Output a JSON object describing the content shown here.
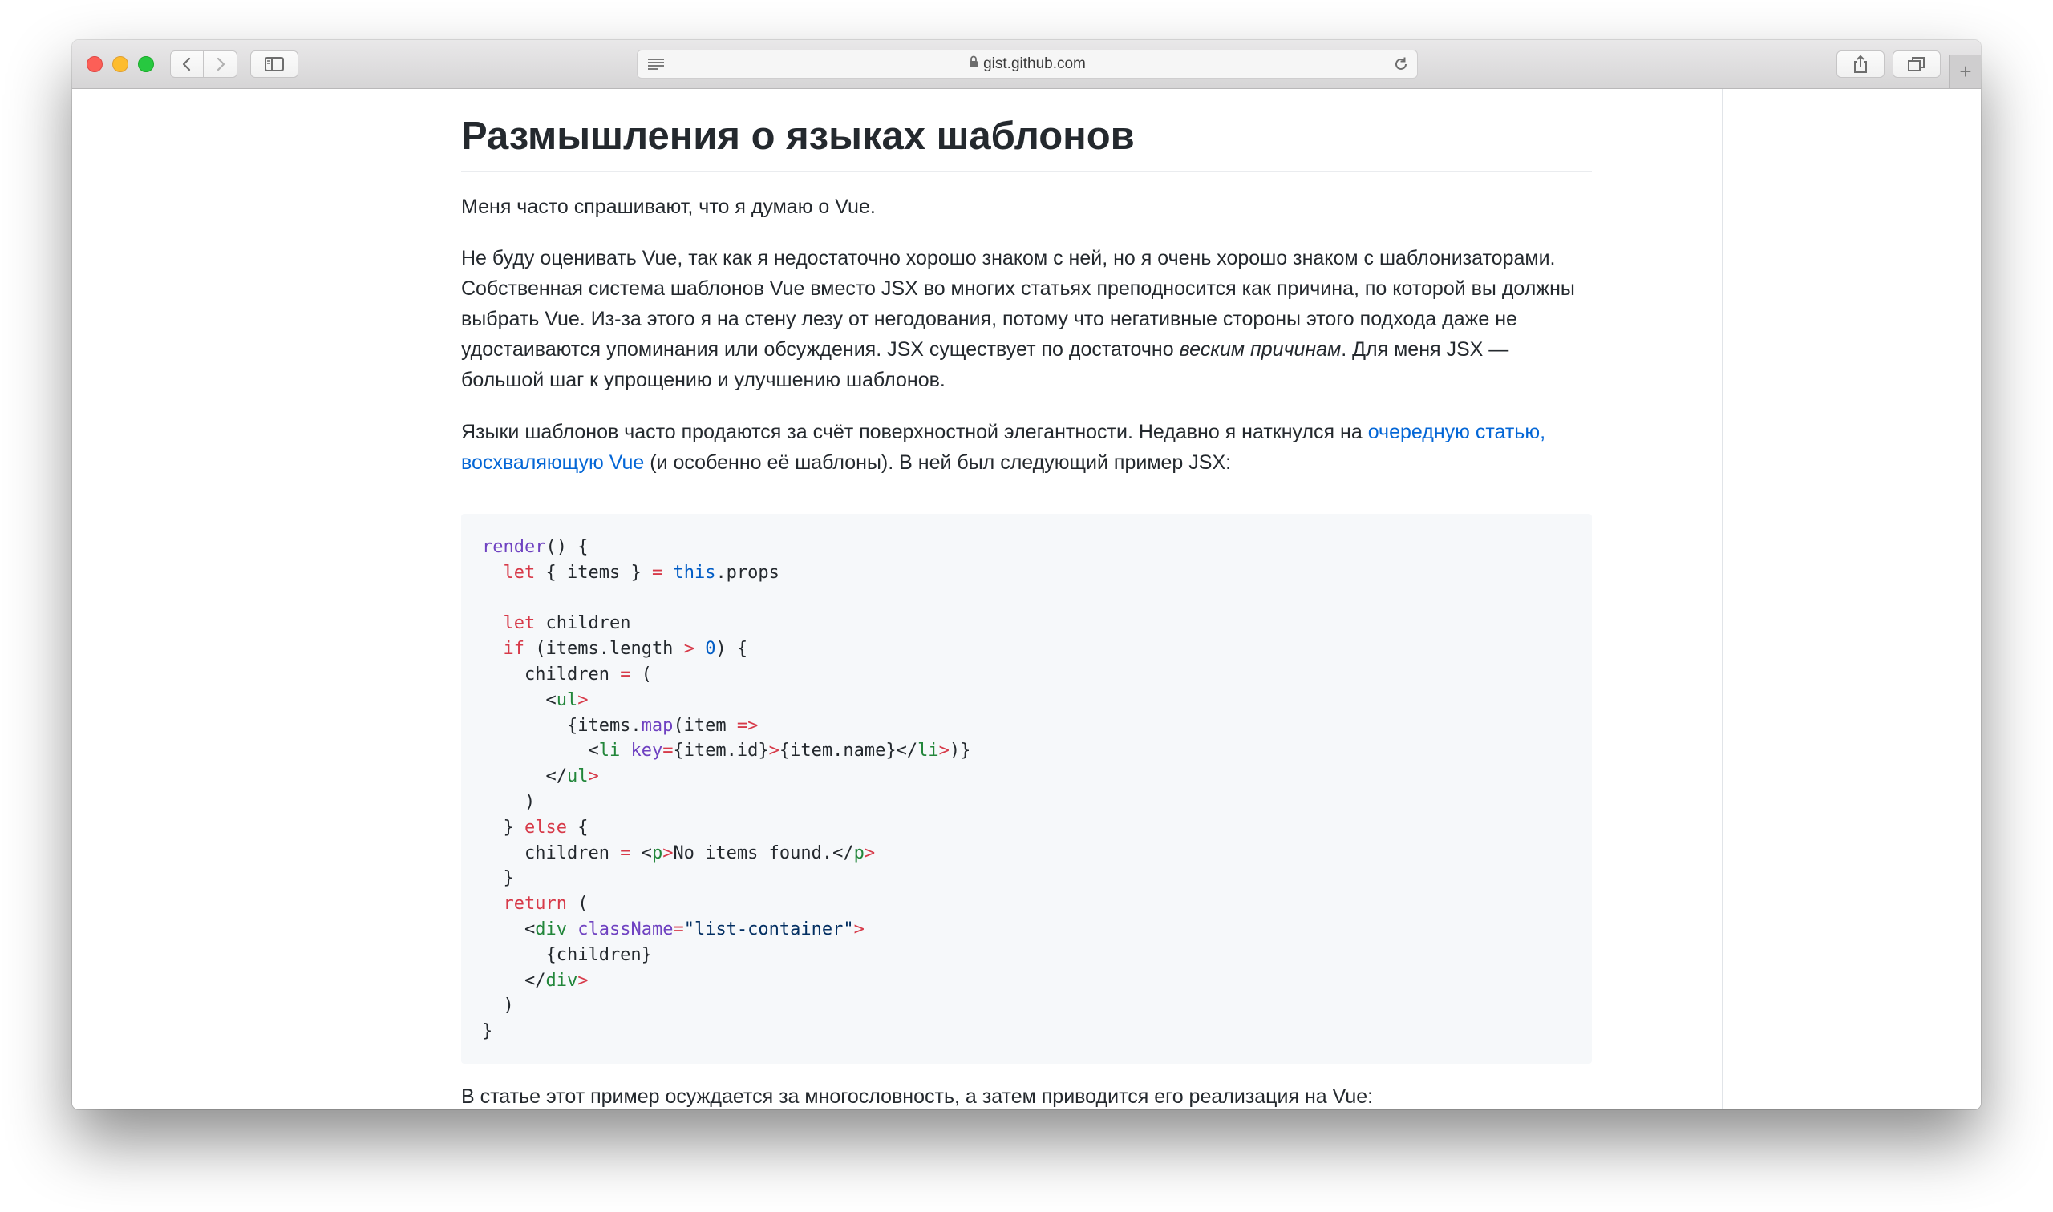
{
  "browser": {
    "url": "gist.github.com",
    "new_tab_label": "+",
    "icons": [
      "close-icon",
      "minimize-icon",
      "zoom-icon",
      "back-icon",
      "forward-icon",
      "sidebar-icon",
      "reader-icon",
      "lock-icon",
      "reload-icon",
      "share-icon",
      "tabs-icon",
      "new-tab-icon"
    ]
  },
  "article": {
    "title": "Размышления о языках шаблонов",
    "p1": "Меня часто спрашивают, что я думаю о Vue.",
    "p2_text": "Не буду оценивать Vue, так как я недостаточно хорошо знаком с ней, но я очень хорошо знаком с шаблонизаторами. Собственная система шаблонов Vue вместо JSX во многих статьях преподносится как причина, по которой вы должны выбрать Vue. Из-за этого я на стену лезу от негодования, потому что негативные стороны этого подхода даже не удостаиваются упоминания или обсуждения. JSX существует по достаточно ",
    "p2_em": "веским причинам",
    "p2_end": ". Для меня JSX — большой шаг к упрощению и улучшению шаблонов.",
    "p3_text": "Языки шаблонов часто продаются за счёт поверхностной элегантности. Недавно я наткнулся на ",
    "p3_link": "очередную статью, восхваляющую Vue",
    "p3_end": " (и особенно её шаблоны). В ней был следующий пример JSX:",
    "p4": "В статье этот пример осуждается за многословность, а затем приводится его реализация на Vue:"
  },
  "code": {
    "language": "JSX",
    "lines": [
      "render() {",
      "  let { items } = this.props",
      "",
      "  let children",
      "  if (items.length > 0) {",
      "    children = (",
      "      <ul>",
      "        {items.map(item =>",
      "          <li key={item.id}>{item.name}</li>)}",
      "      </ul>",
      "    )",
      "  } else {",
      "    children = <p>No items found.</p>",
      "  }",
      "  return (",
      "    <div className=\"list-container\">",
      "      {children}",
      "    </div>",
      "  )",
      "}"
    ]
  },
  "colors": {
    "link": "#0366d6",
    "text": "#24292e",
    "code_bg": "#f6f8fa",
    "keyword": "#d73a49",
    "function": "#6f42c1",
    "constant": "#005cc5",
    "tag": "#22863a",
    "string": "#032f62"
  }
}
